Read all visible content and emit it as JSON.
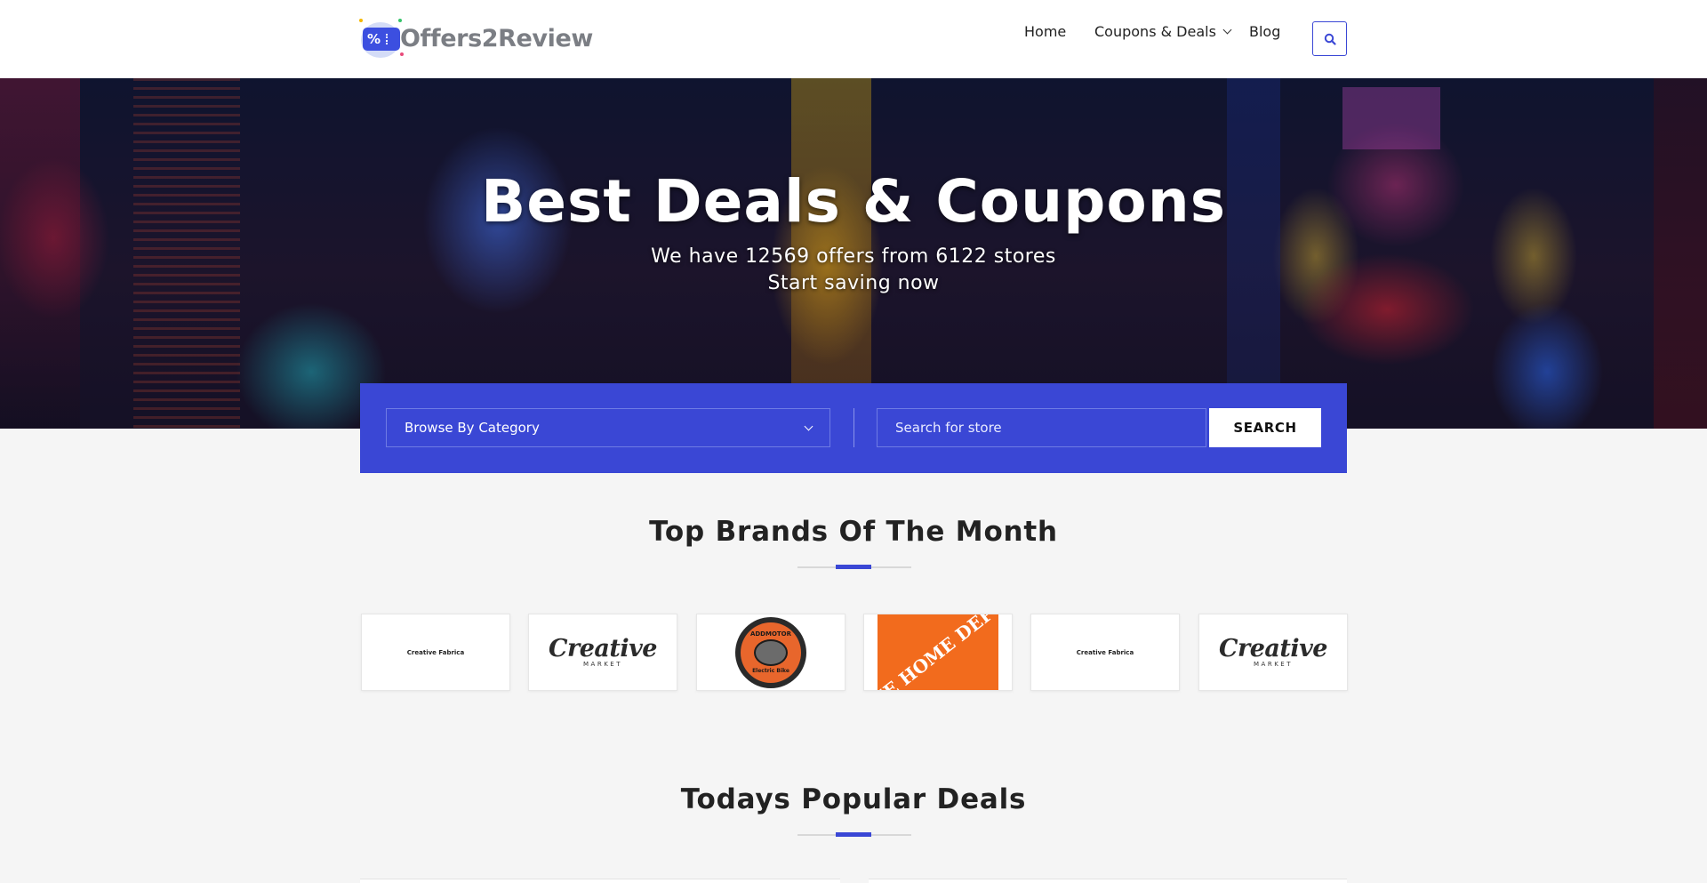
{
  "header": {
    "logo_text": "Offers2Review",
    "logo_mark": "%",
    "nav": {
      "home": "Home",
      "coupons": "Coupons & Deals",
      "blog": "Blog"
    },
    "search_icon": "search-icon"
  },
  "hero": {
    "title": "Best Deals & Coupons",
    "subtitle": "We have 12569 offers from 6122 stores",
    "tagline": "Start saving now"
  },
  "search": {
    "category_label": "Browse By Category",
    "store_placeholder": "Search for store",
    "submit_label": "SEARCH"
  },
  "brands": {
    "title": "Top Brands Of The Month",
    "items": [
      {
        "name": "Creative Fabrica",
        "logo_text": "Creative Fabrica"
      },
      {
        "name": "Creative Market",
        "logo_word": "Creative",
        "logo_sub": "MARKET"
      },
      {
        "name": "Addmotor",
        "logo_top": "ADDMOTOR",
        "logo_bottom": "Electric Bike"
      },
      {
        "name": "The Home Depot",
        "logo_text": "THE HOME DEPOT"
      },
      {
        "name": "Creative Fabrica",
        "logo_text": "Creative Fabrica"
      },
      {
        "name": "Creative Market",
        "logo_word": "Creative",
        "logo_sub": "MARKET"
      }
    ]
  },
  "deals": {
    "title": "Todays Popular Deals"
  },
  "colors": {
    "accent": "#3a47d5",
    "logo_gray": "#7b7e84",
    "home_depot_orange": "#f26b1d"
  }
}
